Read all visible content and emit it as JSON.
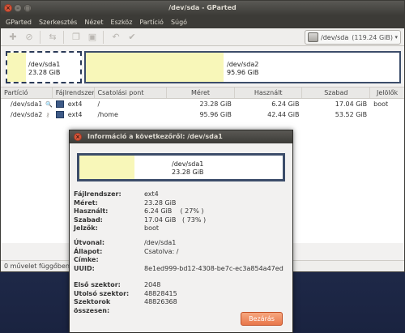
{
  "window": {
    "title": "/dev/sda - GParted"
  },
  "menubar": [
    "GParted",
    "Szerkesztés",
    "Nézet",
    "Eszköz",
    "Partíció",
    "Súgó"
  ],
  "toolbar": {
    "device": "/dev/sda",
    "device_size": "(119.24 GiB)"
  },
  "graph": {
    "partitions": [
      {
        "name": "/dev/sda1",
        "size": "23.28 GiB",
        "used_fraction": 0.27
      },
      {
        "name": "/dev/sda2",
        "size": "95.96 GiB",
        "used_fraction": 0.44
      }
    ]
  },
  "table": {
    "headers": [
      "Partíció",
      "Fájlrendszer",
      "Csatolási pont",
      "Méret",
      "Használt",
      "Szabad",
      "Jelölők"
    ],
    "rows": [
      {
        "partition": "/dev/sda1",
        "fs": "ext4",
        "mount": "/",
        "size": "23.28 GiB",
        "used": "6.24 GiB",
        "free": "17.04 GiB",
        "flags": "boot"
      },
      {
        "partition": "/dev/sda2",
        "fs": "ext4",
        "mount": "/home",
        "size": "95.96 GiB",
        "used": "42.44 GiB",
        "free": "53.52 GiB",
        "flags": ""
      }
    ]
  },
  "statusbar": {
    "text": "0 művelet függőben"
  },
  "dialog": {
    "title": "Információ a következőről: /dev/sda1",
    "graph": {
      "name": "/dev/sda1",
      "size": "23.28 GiB",
      "used_fraction": 0.27
    },
    "info1": [
      {
        "key": "Fájlrendszer:",
        "value": "ext4"
      },
      {
        "key": "Méret:",
        "value": "23.28 GiB"
      },
      {
        "key": "Használt:",
        "value": "6.24 GiB    ( 27% )"
      },
      {
        "key": "Szabad:",
        "value": "17.04 GiB   ( 73% )"
      },
      {
        "key": "Jelzők:",
        "value": "boot"
      }
    ],
    "info2": [
      {
        "key": "Útvonal:",
        "value": "/dev/sda1"
      },
      {
        "key": "Állapot:",
        "value": "Csatolva: /"
      },
      {
        "key": "Címke:",
        "value": ""
      },
      {
        "key": "UUID:",
        "value": "8e1ed999-bd12-4308-be7c-ec3a854a47ed"
      }
    ],
    "info3": [
      {
        "key": "Első szektor:",
        "value": "2048"
      },
      {
        "key": "Utolsó szektor:",
        "value": "48828415"
      },
      {
        "key": "Szektorok összesen:",
        "value": "48826368"
      }
    ],
    "close_label": "Bezárás"
  }
}
